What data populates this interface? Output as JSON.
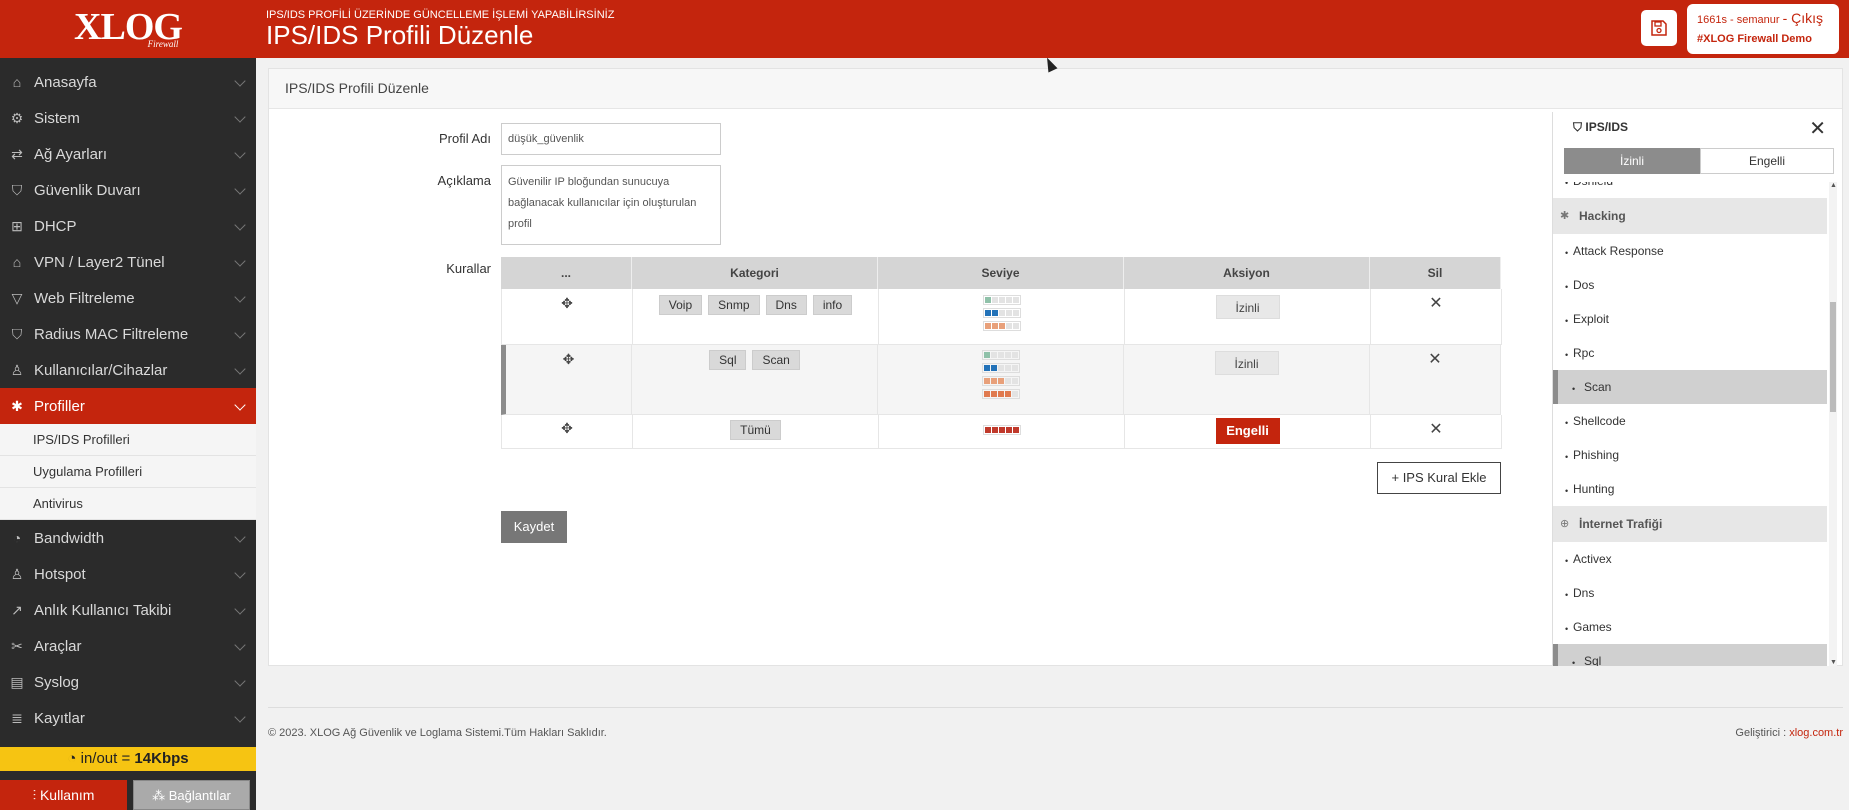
{
  "header": {
    "logo_text": "XLOG",
    "logo_sub": "Firewall",
    "subtitle": "IPS/IDS PROFİLİ ÜZERİNDE GÜNCELLEME İŞLEMİ YAPABİLİRSİNİZ",
    "title": "IPS/IDS Profili Düzenle",
    "user": "1661s - semanur",
    "logout": "Çıkış",
    "demo": "#XLOG Firewall Demo"
  },
  "sidebar": {
    "items": [
      {
        "label": "Anasayfa"
      },
      {
        "label": "Sistem"
      },
      {
        "label": "Ağ Ayarları"
      },
      {
        "label": "Güvenlik Duvarı"
      },
      {
        "label": "DHCP"
      },
      {
        "label": "VPN / Layer2 Tünel"
      },
      {
        "label": "Web Filtreleme"
      },
      {
        "label": "Radius MAC Filtreleme"
      },
      {
        "label": "Kullanıcılar/Cihazlar"
      },
      {
        "label": "Profiller"
      },
      {
        "label": "Bandwidth"
      },
      {
        "label": "Hotspot"
      },
      {
        "label": "Anlık Kullanıcı Takibi"
      },
      {
        "label": "Araçlar"
      },
      {
        "label": "Syslog"
      },
      {
        "label": "Kayıtlar"
      }
    ],
    "submenu": [
      "IPS/IDS Profilleri",
      "Uygulama Profilleri",
      "Antivirus"
    ],
    "traffic_prefix": "in/out = ",
    "traffic_value": "14Kbps",
    "usage_button": "Kullanım",
    "connections_button": "Bağlantılar"
  },
  "main": {
    "card_title": "IPS/IDS Profili Düzenle",
    "profile_name_label": "Profil Adı",
    "profile_name_value": "düşük_güvenlik",
    "description_label": "Açıklama",
    "description_value": "Güvenilir IP bloğundan sunucuya bağlanacak kullanıcılar için oluşturulan profil",
    "rules_label": "Kurallar",
    "table_headers": [
      "...",
      "Kategori",
      "Seviye",
      "Aksiyon",
      "Sil"
    ],
    "rules": [
      {
        "tags": [
          "Voip",
          "Snmp",
          "Dns",
          "info"
        ],
        "action": "İzinli",
        "levels": [
          1,
          2,
          3
        ]
      },
      {
        "tags": [
          "Sql",
          "Scan"
        ],
        "action": "İzinli",
        "levels": [
          1,
          2,
          3,
          4
        ]
      },
      {
        "tags": [
          "Tümü"
        ],
        "action": "Engelli",
        "levels": [
          5
        ]
      }
    ],
    "add_rule_button": "IPS Kural Ekle",
    "save_button": "Kaydet"
  },
  "panel": {
    "title": "IPS/IDS",
    "tab_allowed": "İzinli",
    "tab_blocked": "Engelli",
    "partial_top": "Dshield",
    "group_hacking": "Hacking",
    "hacking_items": [
      "Attack Response",
      "Dos",
      "Exploit",
      "Rpc",
      "Scan",
      "Shellcode",
      "Phishing",
      "Hunting"
    ],
    "selected_item": "Scan",
    "group_internet": "İnternet Trafiği",
    "internet_items": [
      "Activex",
      "Dns",
      "Games",
      "Sql"
    ]
  },
  "footer": {
    "copyright": "© 2023. XLOG Ağ Güvenlik ve Loglama Sistemi.Tüm Hakları Saklıdır.",
    "dev_label": "Geliştirici : ",
    "dev_link": "xlog.com.tr"
  },
  "colors": {
    "brand": "#c4250d",
    "traffic_bar": "#f6c412",
    "level_1": "#8fc1a9",
    "level_2": "#2372b8",
    "level_3": "#e8a07a",
    "level_4": "#e07a4f",
    "level_5": "#c0392b"
  },
  "icons": {
    "save": "floppy-icon",
    "close": "close-icon",
    "move": "move-icon",
    "delete": "x-icon",
    "panel": "shield-icon"
  }
}
